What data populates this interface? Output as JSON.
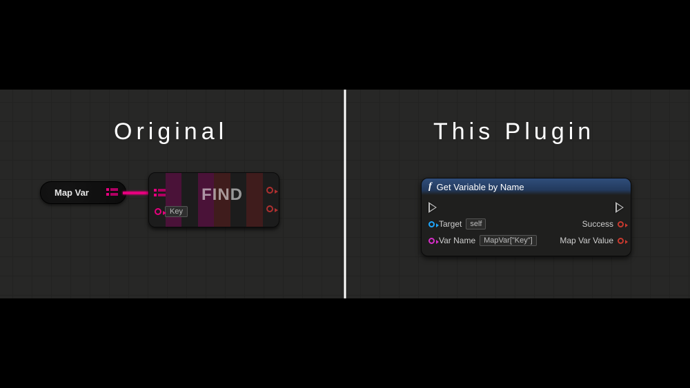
{
  "headings": {
    "left": "Original",
    "right": "This Plugin"
  },
  "leftGraph": {
    "varNode": {
      "label": "Map Var"
    },
    "findNode": {
      "title": "FIND",
      "keyInputLabel": "Key"
    }
  },
  "rightGraph": {
    "node": {
      "title": "Get Variable by Name",
      "pins": {
        "target": {
          "label": "Target",
          "value": "self"
        },
        "varName": {
          "label": "Var Name",
          "value": "MapVar[\"Key\"]"
        },
        "success": {
          "label": "Success"
        },
        "mapVarValue": {
          "label": "Map Var Value"
        }
      }
    }
  }
}
